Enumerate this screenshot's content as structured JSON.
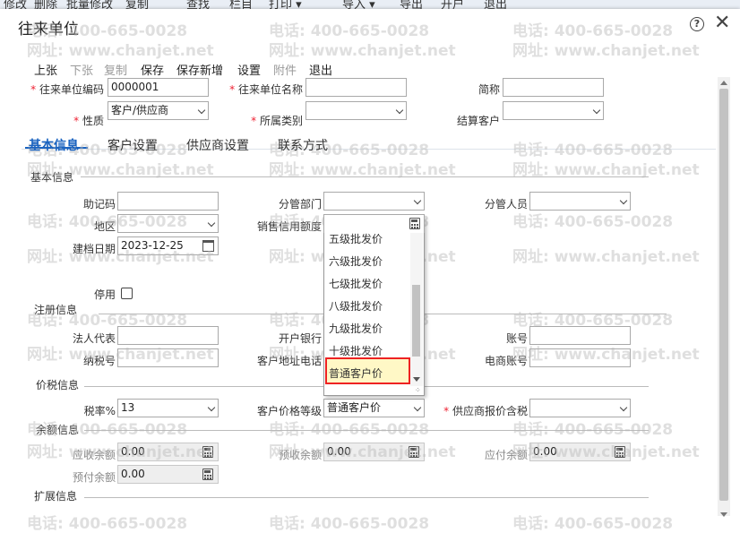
{
  "topmenu": [
    "修改",
    "删除",
    "批量修改",
    "复制",
    "查找",
    "栏目",
    "打印 ▾",
    "导入 ▾",
    "导出",
    "开户",
    "退出"
  ],
  "title": "往来单位",
  "icons": {
    "help": "?",
    "close": "✕"
  },
  "toolbar": [
    {
      "label": "上张",
      "enabled": true
    },
    {
      "label": "下张",
      "enabled": false
    },
    {
      "label": "复制",
      "enabled": false
    },
    {
      "label": "保存",
      "enabled": true
    },
    {
      "label": "保存新增",
      "enabled": true
    },
    {
      "label": "设置",
      "enabled": true
    },
    {
      "label": "附件",
      "enabled": false
    },
    {
      "label": "退出",
      "enabled": true
    }
  ],
  "header": {
    "code_label": "往来单位编码",
    "code_value": "0000001",
    "name_label": "往来单位名称",
    "name_value": "",
    "short_label": "简称",
    "short_value": "",
    "nature_label": "性质",
    "nature_value": "客户/供应商",
    "category_label": "所属类别",
    "category_value": "",
    "settle_label": "结算客户",
    "settle_value": ""
  },
  "tabs": [
    "基本信息",
    "客户设置",
    "供应商设置",
    "联系方式"
  ],
  "basic": {
    "section": "基本信息",
    "memo_label": "助记码",
    "memo_value": "",
    "dept_label": "分管部门",
    "dept_value": "",
    "person_label": "分管人员",
    "person_value": "",
    "region_label": "地区",
    "region_value": "",
    "credit_label": "销售信用额度",
    "date_label": "建档日期",
    "date_value": "2023-12-25",
    "disable_label": "停用"
  },
  "register": {
    "section": "注册信息",
    "legal_label": "法人代表",
    "bank_label": "开户银行",
    "account_label": "账号",
    "tax_label": "纳税号",
    "address_label": "客户地址电话",
    "ecom_label": "电商账号"
  },
  "price": {
    "section": "价税信息",
    "rate_label": "税率%",
    "rate_value": "13",
    "level_label": "客户价格等级",
    "level_value": "普通客户价",
    "supplier_label": "供应商报价含税",
    "supplier_value": ""
  },
  "balance": {
    "section": "余额信息",
    "ar_label": "应收余额",
    "ar_value": "0.00",
    "pre_recv_label": "预收余额",
    "pre_recv_value": "0.00",
    "ap_label": "应付余额",
    "ap_value": "0.00",
    "pre_pay_label": "预付余额",
    "pre_pay_value": "0.00"
  },
  "ext": {
    "section": "扩展信息"
  },
  "dropdown": {
    "items": [
      "五级批发价",
      "六级批发价",
      "七级批发价",
      "八级批发价",
      "九级批发价",
      "十级批发价",
      "普通客户价"
    ],
    "selected": "普通客户价"
  },
  "watermark": {
    "phone": "电话: 400-665-0028",
    "web": "网址: www.chanjet.net"
  }
}
